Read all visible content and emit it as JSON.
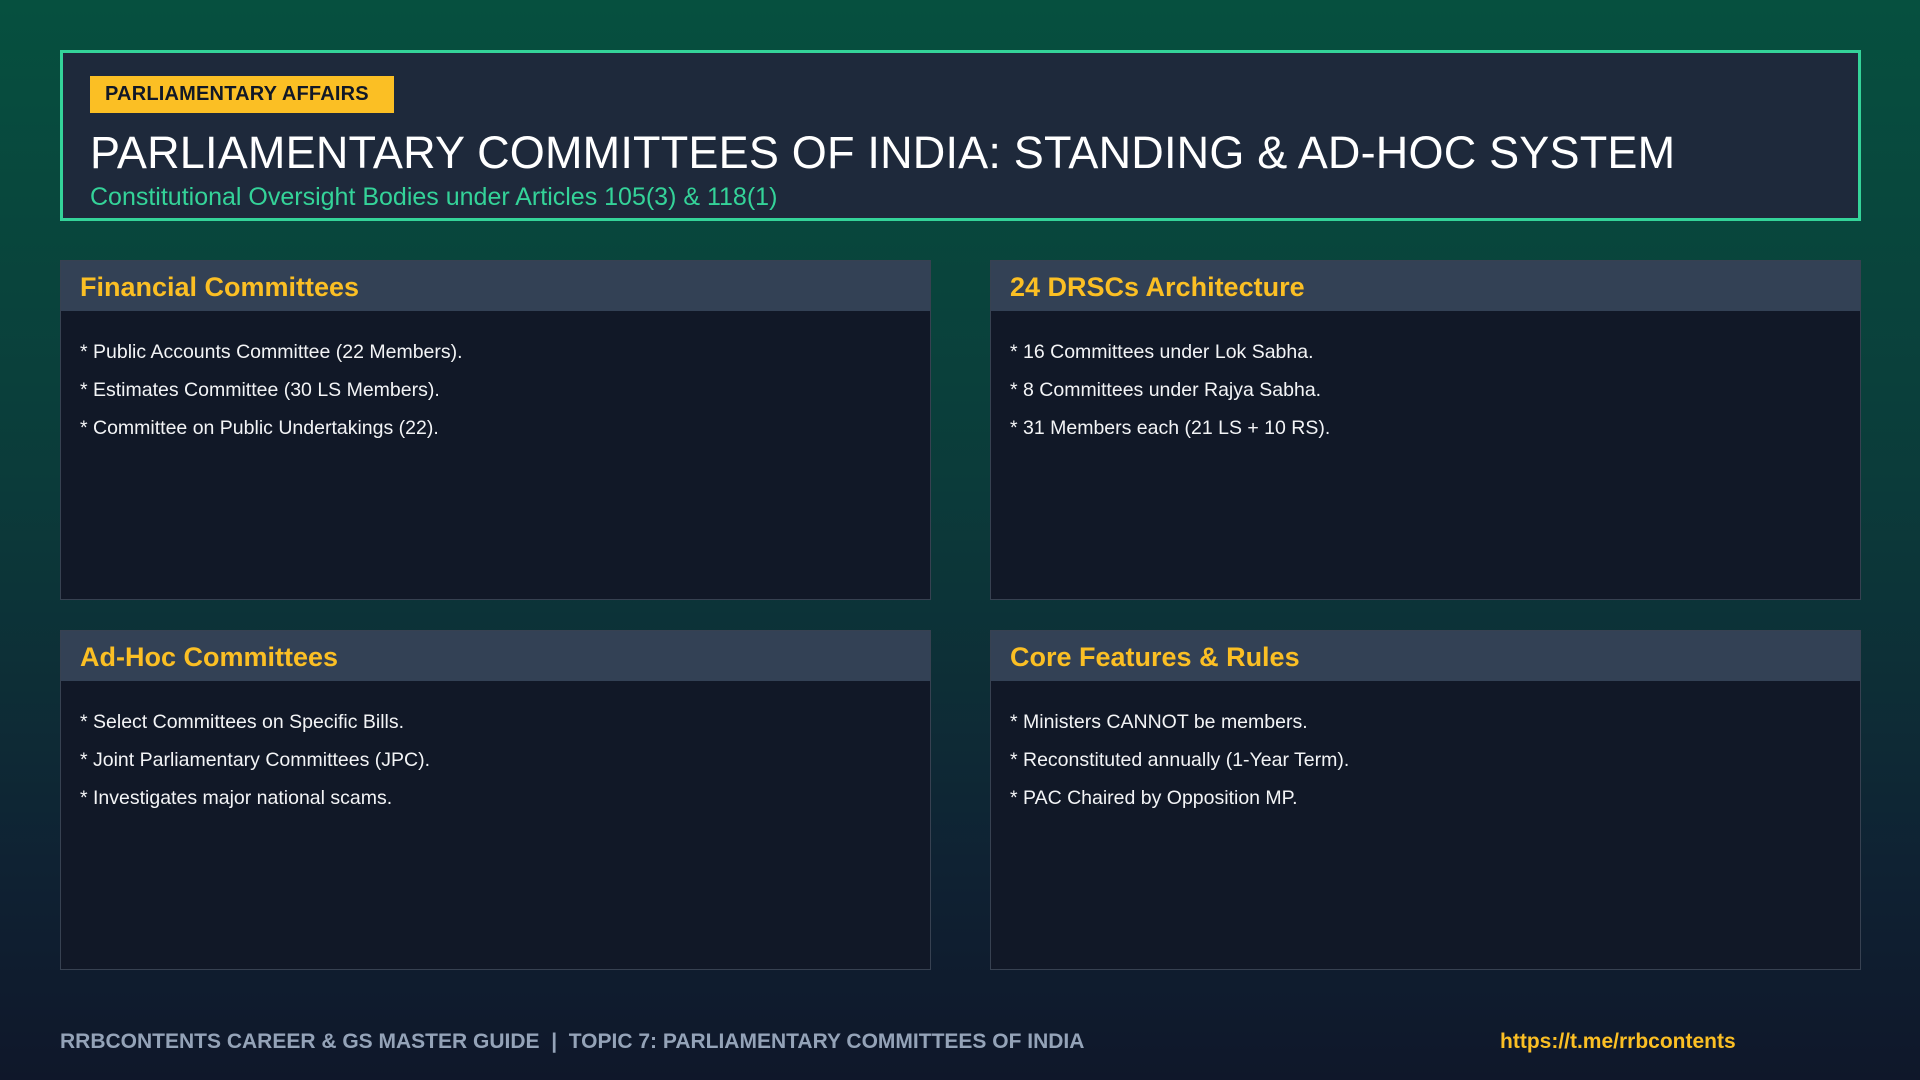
{
  "header": {
    "badge": "PARLIAMENTARY AFFAIRS",
    "title": "PARLIAMENTARY COMMITTEES OF INDIA: STANDING & AD-HOC SYSTEM",
    "subtitle": "Constitutional Oversight Bodies under Articles 105(3) & 118(1)"
  },
  "cards": [
    {
      "title": "Financial Committees",
      "items": [
        "* Public Accounts Committee (22 Members).",
        "* Estimates Committee (30 LS Members).",
        "* Committee on Public Undertakings (22)."
      ]
    },
    {
      "title": "24 DRSCs Architecture",
      "items": [
        "* 16 Committees under Lok Sabha.",
        "* 8 Committees under Rajya Sabha.",
        "* 31 Members each (21 LS + 10 RS)."
      ]
    },
    {
      "title": "Ad-Hoc Committees",
      "items": [
        "* Select Committees on Specific Bills.",
        "* Joint Parliamentary Committees (JPC).",
        "* Investigates major national scams."
      ]
    },
    {
      "title": "Core Features & Rules",
      "items": [
        "* Ministers CANNOT be members.",
        "* Reconstituted annually (1-Year Term).",
        "* PAC Chaired by Opposition MP."
      ]
    }
  ],
  "footer": {
    "left": "RRBCONTENTS CAREER & GS MASTER GUIDE  |  TOPIC 7: PARLIAMENTARY COMMITTEES OF INDIA",
    "link": "https://t.me/rrbcontents"
  },
  "colors": {
    "accent_green": "#34d399",
    "accent_yellow": "#fbbf24",
    "panel": "#111827",
    "panel_header": "#334155"
  }
}
